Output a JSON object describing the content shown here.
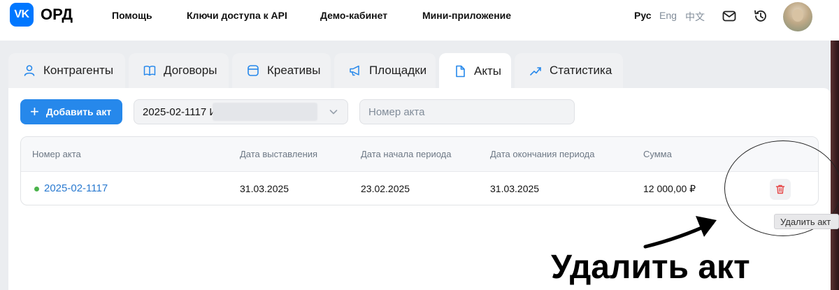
{
  "header": {
    "logo_text": "VK",
    "brand": "ОРД",
    "nav": [
      "Помощь",
      "Ключи доступа к API",
      "Демо-кабинет",
      "Мини-приложение"
    ],
    "languages": {
      "active": "Рус",
      "others": [
        "Eng",
        "中文"
      ]
    },
    "icons": [
      "mail-icon",
      "history-icon",
      "avatar"
    ]
  },
  "tabs": [
    {
      "label": "Контрагенты",
      "icon": "user-icon",
      "active": false
    },
    {
      "label": "Договоры",
      "icon": "book-icon",
      "active": false
    },
    {
      "label": "Креативы",
      "icon": "creative-icon",
      "active": false
    },
    {
      "label": "Площадки",
      "icon": "megaphone-icon",
      "active": false
    },
    {
      "label": "Акты",
      "icon": "document-icon",
      "active": true
    },
    {
      "label": "Статистика",
      "icon": "chart-icon",
      "active": false
    }
  ],
  "toolbar": {
    "add_label": "Добавить акт",
    "contract_select_value": "2025-02-1117 И",
    "search_placeholder": "Номер акта"
  },
  "table": {
    "columns": [
      "Номер акта",
      "Дата выставления",
      "Дата начала периода",
      "Дата окончания периода",
      "Сумма"
    ],
    "rows": [
      {
        "number": "2025-02-1117",
        "issued": "31.03.2025",
        "period_start": "23.02.2025",
        "period_end": "31.03.2025",
        "amount": "12 000,00 ₽",
        "status_color": "#4bb34b"
      }
    ]
  },
  "tooltip": "Удалить акт",
  "annotation": "Удалить акт",
  "colors": {
    "primary": "#2688eb",
    "link": "#2a7ad0",
    "danger": "#e64646",
    "status": "#4bb34b"
  }
}
